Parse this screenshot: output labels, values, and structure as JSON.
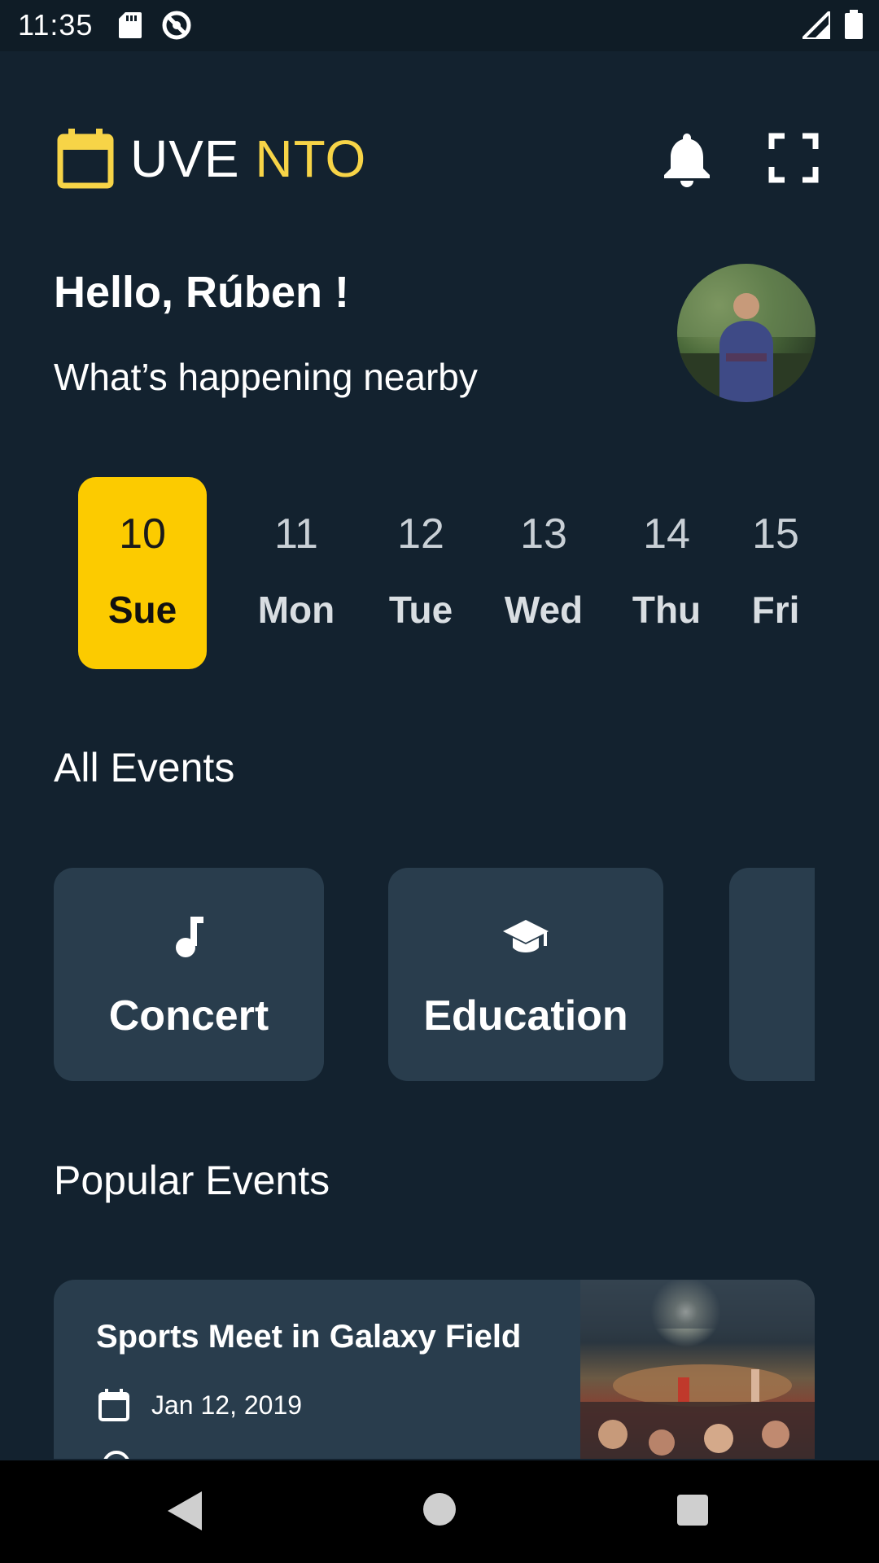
{
  "status_bar": {
    "time": "11:35",
    "icons": [
      "sd-card-icon",
      "sync-icon",
      "signal-icon",
      "battery-icon"
    ]
  },
  "header": {
    "logo_part1": "UVE ",
    "logo_part2": "NTO",
    "logo_icon": "calendar-icon",
    "notification_icon": "bell-icon",
    "fullscreen_icon": "fullscreen-icon"
  },
  "greeting": {
    "title": "Hello, Rúben !",
    "subtitle": "What’s happening nearby"
  },
  "dates": [
    {
      "num": "10",
      "day": "Sue",
      "selected": true
    },
    {
      "num": "11",
      "day": "Mon",
      "selected": false
    },
    {
      "num": "12",
      "day": "Tue",
      "selected": false
    },
    {
      "num": "13",
      "day": "Wed",
      "selected": false
    },
    {
      "num": "14",
      "day": "Thu",
      "selected": false
    },
    {
      "num": "15",
      "day": "Fri",
      "selected": false
    }
  ],
  "sections": {
    "all_events": "All Events",
    "popular_events": "Popular Events"
  },
  "categories": [
    {
      "label": "Concert",
      "icon": "music-note-icon"
    },
    {
      "label": "Education",
      "icon": "graduation-cap-icon"
    },
    {
      "label": "",
      "icon": ""
    }
  ],
  "popular_events": [
    {
      "title": "Sports Meet in Galaxy Field",
      "date": "Jan 12, 2019",
      "date_icon": "calendar-icon"
    }
  ],
  "colors": {
    "background": "#13222f",
    "card": "#293d4d",
    "accent": "#fccb00",
    "logo_accent": "#f7d447"
  },
  "nav": {
    "icons": [
      "back-icon",
      "home-icon",
      "recents-icon"
    ]
  }
}
